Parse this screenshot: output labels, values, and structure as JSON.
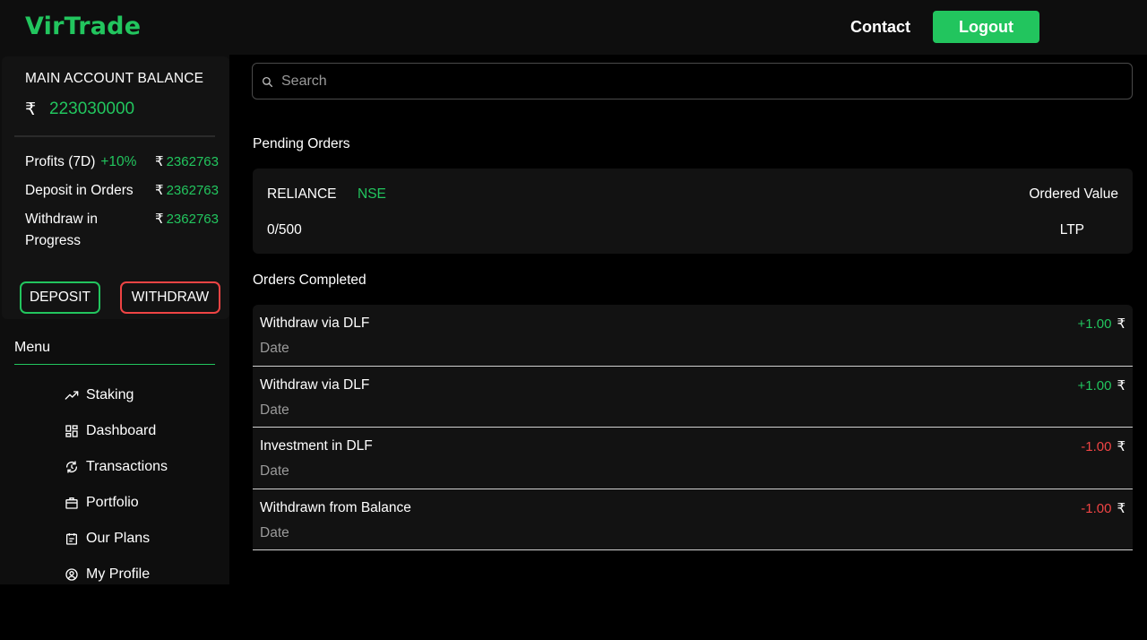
{
  "header": {
    "logo": "VirTrade",
    "contact": "Contact",
    "logout": "Logout"
  },
  "sidebar": {
    "balance_title": "MAIN ACCOUNT BALANCE",
    "currency": "₹",
    "balance_value": "223030000",
    "stats": {
      "profits_label": "Profits (7D)",
      "profits_pct": "+10%",
      "profits_value": "2362763",
      "deposit_label": "Deposit in Orders",
      "deposit_value": "2362763",
      "withdraw_label": "Withdraw in Progress",
      "withdraw_value": "2362763"
    },
    "deposit_button": "DEPOSIT",
    "withdraw_button": "WITHDRAW",
    "menu_title": "Menu",
    "menu": [
      {
        "label": "Staking",
        "icon": "trending-up-icon"
      },
      {
        "label": "Dashboard",
        "icon": "grid-icon"
      },
      {
        "label": "Transactions",
        "icon": "exchange-icon"
      },
      {
        "label": "Portfolio",
        "icon": "briefcase-icon"
      },
      {
        "label": "Our Plans",
        "icon": "calendar-icon"
      },
      {
        "label": "My Profile",
        "icon": "user-circle-icon"
      }
    ]
  },
  "search": {
    "placeholder": "Search",
    "value": ""
  },
  "pending": {
    "title": "Pending Orders",
    "symbol": "RELIANCE",
    "exchange": "NSE",
    "ordered_value_label": "Ordered Value",
    "quantity": "0/500",
    "ltp_label": "LTP"
  },
  "completed": {
    "title": "Orders Completed",
    "orders": [
      {
        "title": "Withdraw via DLF",
        "date": "Date",
        "amount": "+1.00",
        "currency": "₹"
      },
      {
        "title": "Withdraw via DLF",
        "date": "Date",
        "amount": "+1.00",
        "currency": "₹"
      },
      {
        "title": "Investment in DLF",
        "date": "Date",
        "amount": "-1.00",
        "currency": "₹"
      },
      {
        "title": "Withdrawn from Balance",
        "date": "Date",
        "amount": "-1.00",
        "currency": "₹"
      }
    ]
  },
  "colors": {
    "accent": "#22c55e",
    "danger": "#ef4444",
    "panel": "#121212",
    "background": "#000000"
  }
}
